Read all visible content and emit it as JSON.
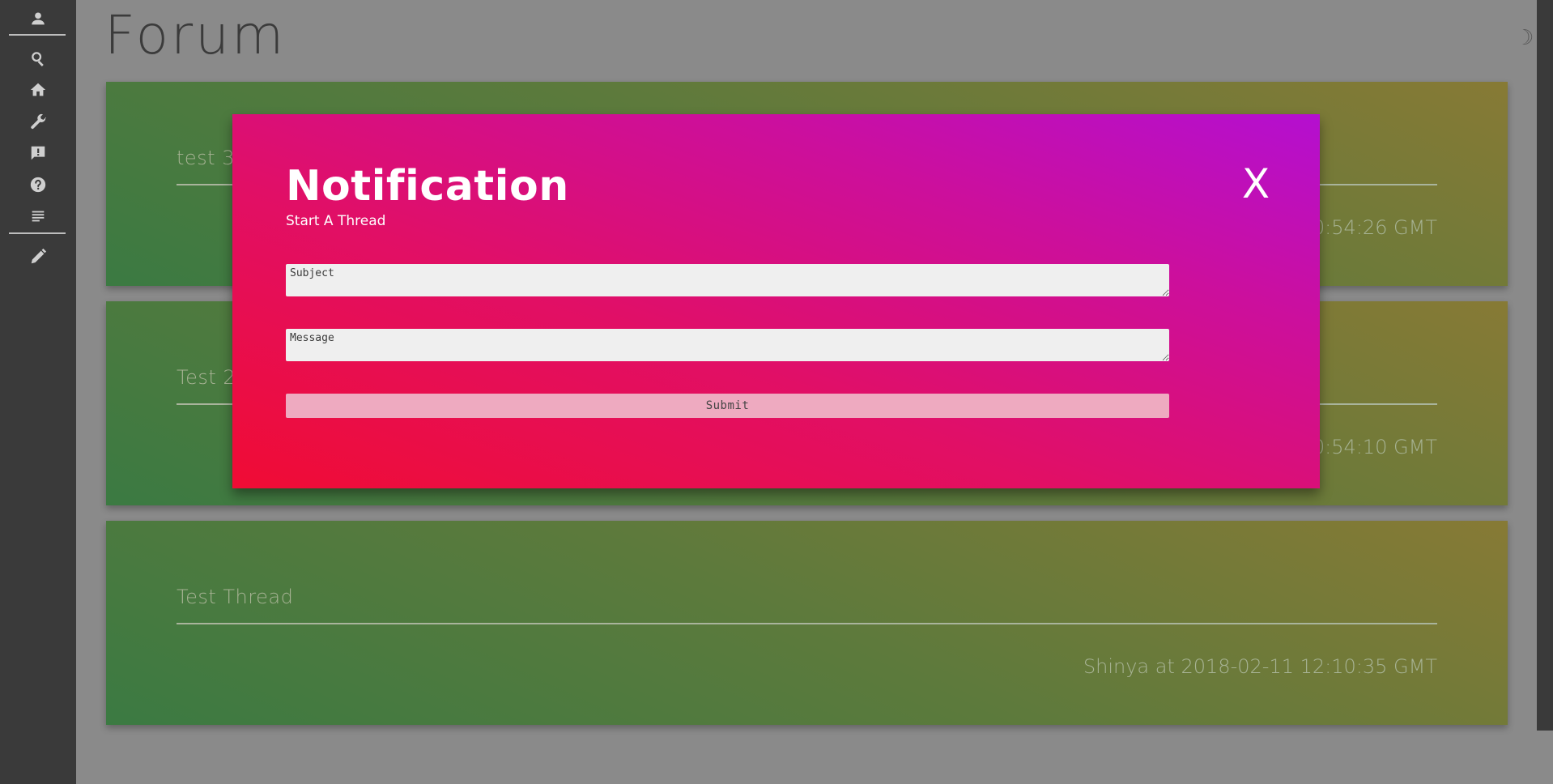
{
  "sidebar": {
    "items": [
      {
        "name": "profile-icon"
      },
      {
        "name": "search-icon"
      },
      {
        "name": "home-icon"
      },
      {
        "name": "wrench-icon"
      },
      {
        "name": "feedback-icon"
      },
      {
        "name": "help-icon"
      },
      {
        "name": "list-icon"
      },
      {
        "name": "pencil-icon"
      }
    ]
  },
  "page": {
    "title": "Forum",
    "theme_toggle_icon": "moon-icon"
  },
  "threads": [
    {
      "title": "test 3",
      "meta": "Shinya at 2018-02-11 12:10:54:26 GMT"
    },
    {
      "title": "Test 2",
      "meta": "Shinya at 2018-02-11 12:10:54:10 GMT"
    },
    {
      "title": "Test Thread",
      "meta": "Shinya at 2018-02-11 12:10:35 GMT"
    }
  ],
  "modal": {
    "title": "Notification",
    "subtitle": "Start A Thread",
    "close_label": "X",
    "subject_placeholder": "Subject",
    "message_placeholder": "Message",
    "submit_label": "Submit"
  },
  "colors": {
    "sidebar_bg": "#3a3a3a",
    "page_bg": "#8a8a8a",
    "modal_gradient_start": "#f00c34",
    "modal_gradient_end": "#b40fd0",
    "thread_gradient_start": "#3b7a42",
    "thread_gradient_end": "#877a35"
  }
}
